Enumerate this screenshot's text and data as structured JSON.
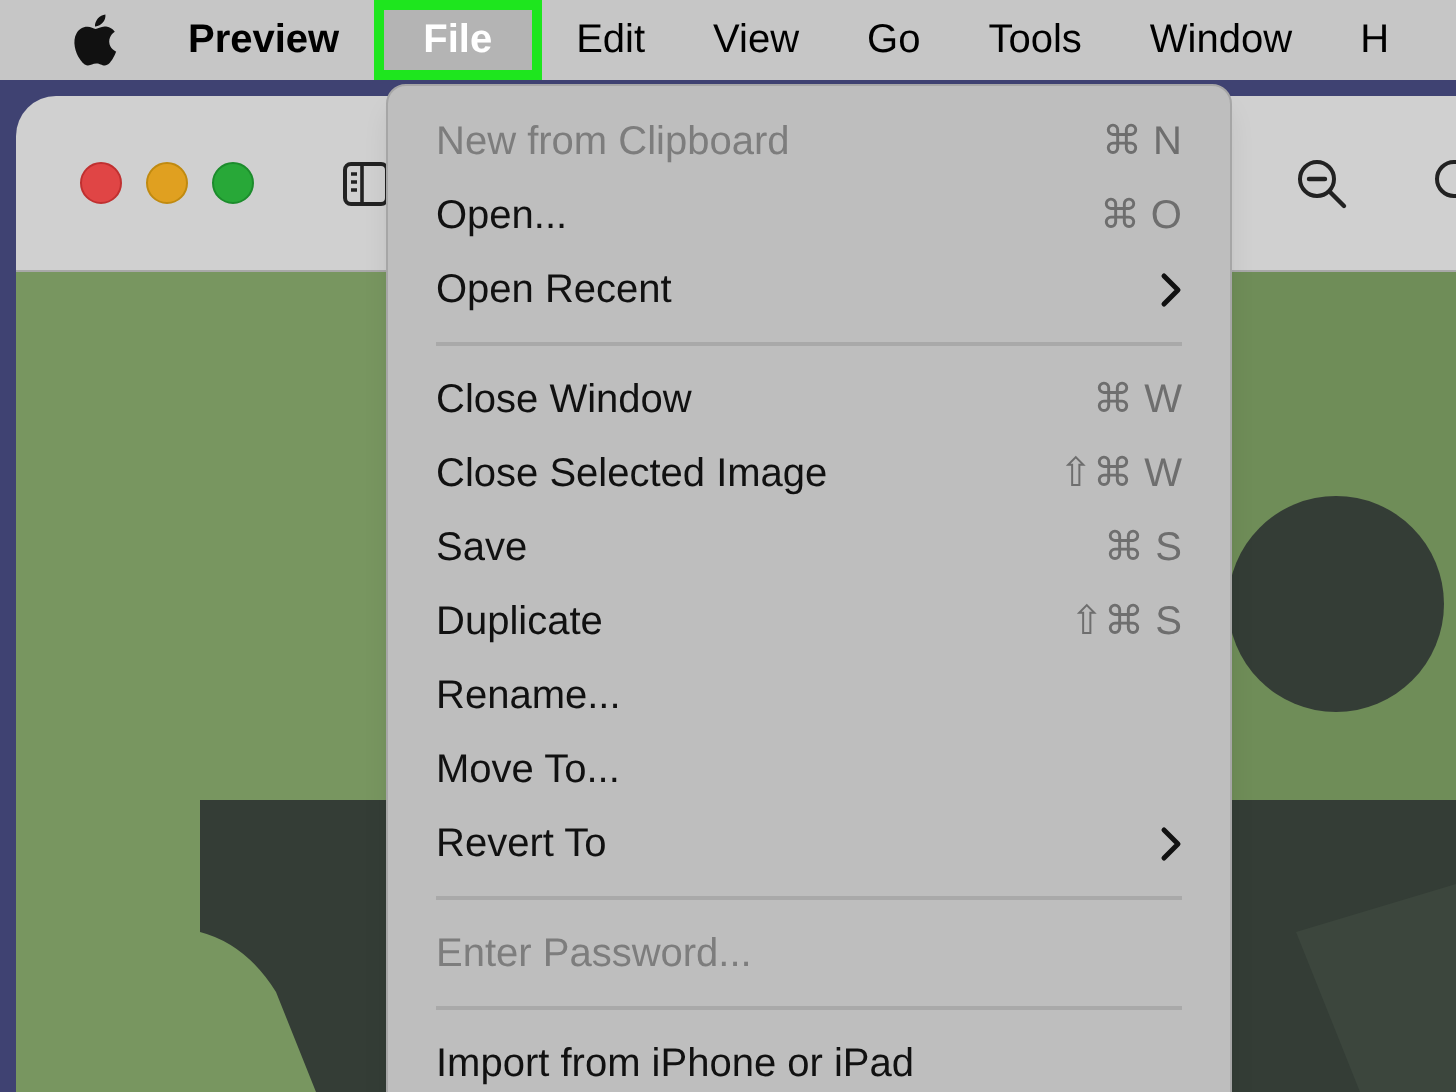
{
  "menu_bar": [
    {
      "label": "Preview",
      "kind": "app",
      "selected": false
    },
    {
      "label": "File",
      "kind": "menu",
      "selected": true
    },
    {
      "label": "Edit",
      "kind": "menu",
      "selected": false
    },
    {
      "label": "View",
      "kind": "menu",
      "selected": false
    },
    {
      "label": "Go",
      "kind": "menu",
      "selected": false
    },
    {
      "label": "Tools",
      "kind": "menu",
      "selected": false
    },
    {
      "label": "Window",
      "kind": "menu",
      "selected": false
    },
    {
      "label": "H",
      "kind": "menu",
      "selected": false
    }
  ],
  "file_menu": [
    {
      "kind": "item",
      "label": "New from Clipboard",
      "shortcut": "⌘ N",
      "disabled": true,
      "submenu": false
    },
    {
      "kind": "item",
      "label": "Open...",
      "shortcut": "⌘ O",
      "disabled": false,
      "submenu": false
    },
    {
      "kind": "item",
      "label": "Open Recent",
      "disabled": false,
      "submenu": true
    },
    {
      "kind": "separator"
    },
    {
      "kind": "item",
      "label": "Close Window",
      "shortcut": "⌘ W",
      "disabled": false,
      "submenu": false
    },
    {
      "kind": "item",
      "label": "Close Selected Image",
      "shortcut": "⇧⌘ W",
      "disabled": false,
      "submenu": false
    },
    {
      "kind": "item",
      "label": "Save",
      "shortcut": "⌘ S",
      "disabled": false,
      "submenu": false
    },
    {
      "kind": "item",
      "label": "Duplicate",
      "shortcut": "⇧⌘ S",
      "disabled": false,
      "submenu": false
    },
    {
      "kind": "item",
      "label": "Rename...",
      "disabled": false,
      "submenu": false
    },
    {
      "kind": "item",
      "label": "Move To...",
      "disabled": false,
      "submenu": false
    },
    {
      "kind": "item",
      "label": "Revert To",
      "disabled": false,
      "submenu": true
    },
    {
      "kind": "separator"
    },
    {
      "kind": "item",
      "label": "Enter Password...",
      "disabled": true,
      "submenu": false
    },
    {
      "kind": "separator"
    },
    {
      "kind": "item",
      "label": "Import from iPhone or iPad",
      "disabled": false,
      "submenu": false
    }
  ]
}
